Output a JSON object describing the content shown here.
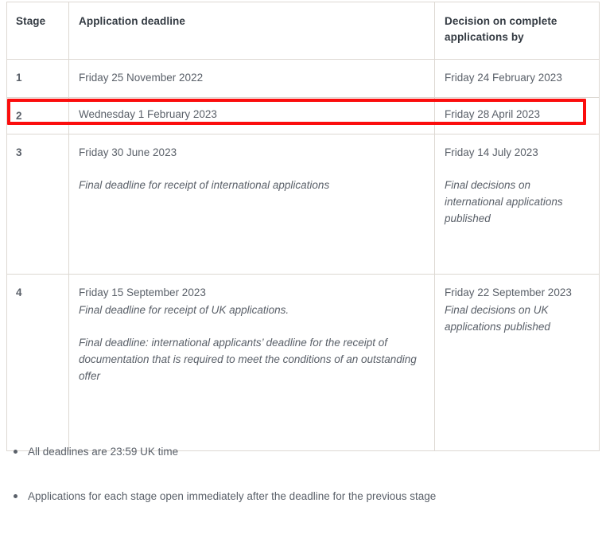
{
  "table": {
    "headers": [
      "Stage",
      "Application deadline",
      "Decision on complete applications by"
    ],
    "rows": [
      {
        "stage": "1",
        "application": {
          "date": "Friday 25 November 2022",
          "note": ""
        },
        "decision": {
          "date": "Friday 24 February 2023",
          "note": ""
        }
      },
      {
        "stage": "2",
        "application": {
          "date": "Wednesday 1 February 2023",
          "note": ""
        },
        "decision": {
          "date": "Friday 28 April 2023",
          "note": ""
        },
        "highlighted": true
      },
      {
        "stage": "3",
        "application": {
          "date": "Friday 30 June 2023",
          "note": "Final deadline for receipt of international applications"
        },
        "decision": {
          "date": "Friday 14 July 2023",
          "note": "Final decisions on international applications published"
        }
      },
      {
        "stage": "4",
        "application": {
          "date": "Friday 15 September 2023",
          "note": "Final deadline for receipt of UK applications.",
          "note2": "Final deadline: international applicants’ deadline for the receipt of documentation that is required to meet the conditions of an outstanding offer"
        },
        "decision": {
          "date": "Friday 22 September 2023",
          "note": "Final decisions on UK applications published"
        }
      }
    ]
  },
  "notes": [
    "All deadlines are 23:59 UK time",
    "Applications for each stage open immediately after the deadline for the previous stage"
  ],
  "colors": {
    "highlight_border": "#fb0d0d",
    "table_border": "#ddd8d2",
    "header_text": "#333a42",
    "body_text": "#5a6069"
  }
}
